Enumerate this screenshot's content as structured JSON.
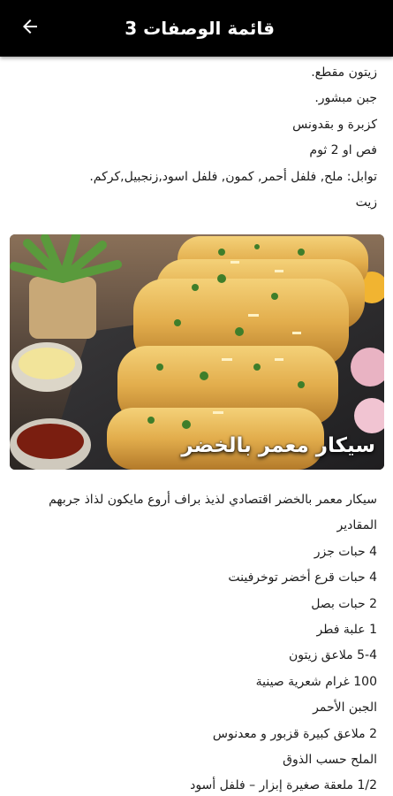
{
  "appbar": {
    "title": "قائمة الوصفات 3",
    "back_icon": "arrow-back-icon"
  },
  "top_lines": [
    "زيتون مقطع.",
    "جبن مبشور.",
    "كزبرة و بقدونس",
    "فص او 2 ثوم",
    "توابل: ملح, فلفل أحمر, كمون, فلفل اسود,زنجبيل,كركم.",
    "زيت"
  ],
  "hero": {
    "caption": "سيكار معمر بالخضر"
  },
  "bottom_lines": [
    "سيكار معمر بالخضر اقتصادي لذيذ براف أروع مايكون لذاذ جربهم",
    "المقادير",
    "4 حبات جزر",
    "4 حبات قرع أخضر توخرفينت",
    "2 حبات بصل",
    "1 علبة فطر",
    "5-4 ملاعق زيتون",
    "100 غرام شعرية صينية",
    "الجبن الأحمر",
    "2 ملاعق كبيرة قزبور و معدنوس",
    "الملح حسب الذوق",
    "1/2 ملعقة صغيرة إبزار – فلفل أسود"
  ]
}
